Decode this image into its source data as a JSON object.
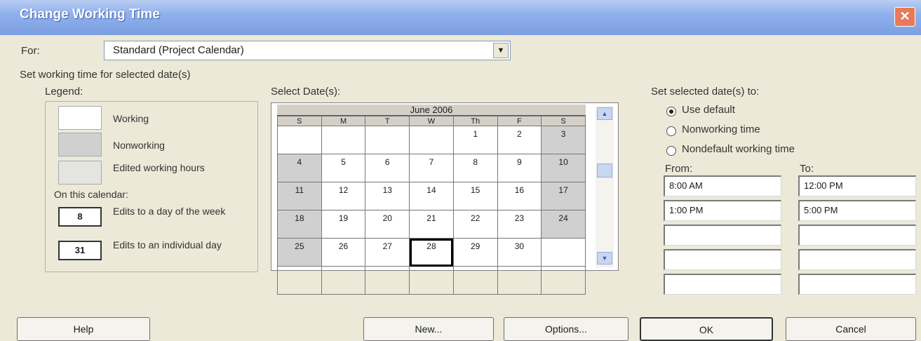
{
  "window": {
    "title": "Change Working Time"
  },
  "for_field": {
    "label": "For:",
    "value": "Standard (Project Calendar)"
  },
  "section_label": "Set working time for selected date(s)",
  "legend": {
    "title": "Legend:",
    "items": [
      {
        "label": "Working",
        "color": "#ffffff"
      },
      {
        "label": "Nonworking",
        "color": "#d0d0d0"
      },
      {
        "label": "Edited working hours",
        "color": "#e4e4e0"
      }
    ],
    "on_calendar_title": "On this calendar:",
    "calendar_items": [
      {
        "badge": "8",
        "label": "Edits to a day of the week"
      },
      {
        "badge": "31",
        "label": "Edits to an individual day"
      }
    ]
  },
  "calendar": {
    "title": "Select Date(s):",
    "month_label": "June 2006",
    "weekdays": [
      "S",
      "M",
      "T",
      "W",
      "Th",
      "F",
      "S"
    ],
    "weeks": [
      [
        "",
        "",
        "",
        "",
        "1",
        "2",
        "3"
      ],
      [
        "4",
        "5",
        "6",
        "7",
        "8",
        "9",
        "10"
      ],
      [
        "11",
        "12",
        "13",
        "14",
        "15",
        "16",
        "17"
      ],
      [
        "18",
        "19",
        "20",
        "21",
        "22",
        "23",
        "24"
      ],
      [
        "25",
        "26",
        "27",
        "28",
        "29",
        "30",
        ""
      ],
      [
        "",
        "",
        "",
        "",
        "",
        "",
        ""
      ]
    ],
    "selected_day": "28"
  },
  "set_dates": {
    "title": "Set selected date(s) to:",
    "options": [
      {
        "label": "Use default",
        "selected": true
      },
      {
        "label": "Nonworking time",
        "selected": false
      },
      {
        "label": "Nondefault working time",
        "selected": false
      }
    ],
    "from_label": "From:",
    "to_label": "To:",
    "rows": [
      {
        "from": "8:00 AM",
        "to": "12:00 PM"
      },
      {
        "from": "1:00 PM",
        "to": "5:00 PM"
      },
      {
        "from": "",
        "to": ""
      },
      {
        "from": "",
        "to": ""
      },
      {
        "from": "",
        "to": ""
      }
    ]
  },
  "buttons": {
    "help": "Help",
    "new": "New...",
    "options": "Options...",
    "ok": "OK",
    "cancel": "Cancel"
  }
}
